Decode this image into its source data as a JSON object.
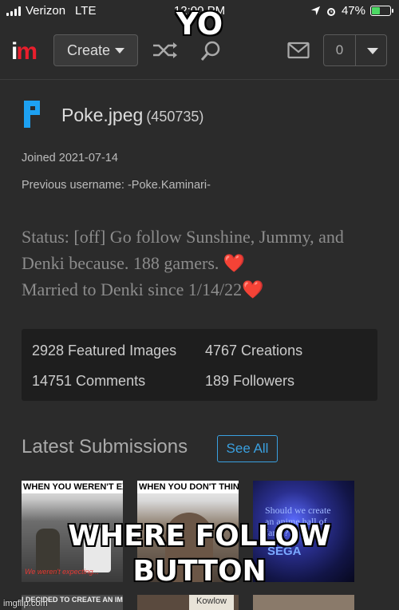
{
  "status_bar": {
    "carrier": "Verizon",
    "network": "LTE",
    "time": "12:00 PM",
    "battery": "47%",
    "battery_level": 0.47,
    "icons": [
      "signal-bars-icon",
      "location-arrow-icon",
      "alarm-clock-icon",
      "battery-icon"
    ]
  },
  "header": {
    "logo": {
      "i": "i",
      "m": "m"
    },
    "create_label": "Create",
    "notification_count": "0",
    "icons": [
      "shuffle-icon",
      "search-icon",
      "mail-icon",
      "chevron-down-icon"
    ],
    "brand_color": "#e91e2c"
  },
  "profile": {
    "username": "Poke.jpeg",
    "user_id": "(450735)",
    "joined": "Joined 2021-07-14",
    "previous_username": "Previous username: -Poke.Kaminari-",
    "status_line": "Status: [off] Go follow Sunshine, Jummy, and Denki because. 188 gamers. ",
    "status_line2": "Married to Denki since 1/14/22",
    "heart": "❤️",
    "avatar_color": "#1da1f2"
  },
  "stats": {
    "featured": "2928 Featured Images",
    "creations": "4767 Creations",
    "comments": "14751 Comments",
    "followers": "189 Followers"
  },
  "submissions": {
    "title": "Latest Submissions",
    "see_all": "See All",
    "thumbs": [
      {
        "caption": "WHEN YOU WEREN'T EXPECTING SPECIAL FORCES",
        "subcaption": "We weren't expecting..."
      },
      {
        "caption": "WHEN YOU DON'T THINK"
      },
      {
        "caption": "Should we create an anime hall of fame?",
        "caption2": "SEGA"
      }
    ],
    "row2": [
      {
        "caption": "I DECIDED TO CREATE AN IMGFLIP HALL OF FAME"
      },
      {
        "caption": "Kowlow"
      },
      {
        "caption": ""
      }
    ],
    "accent_color": "#3aa0e0"
  },
  "meme": {
    "top_text": "YO",
    "bottom_text": "WHERE FOLLOW BUTTON",
    "watermark": "imgflip.com"
  }
}
